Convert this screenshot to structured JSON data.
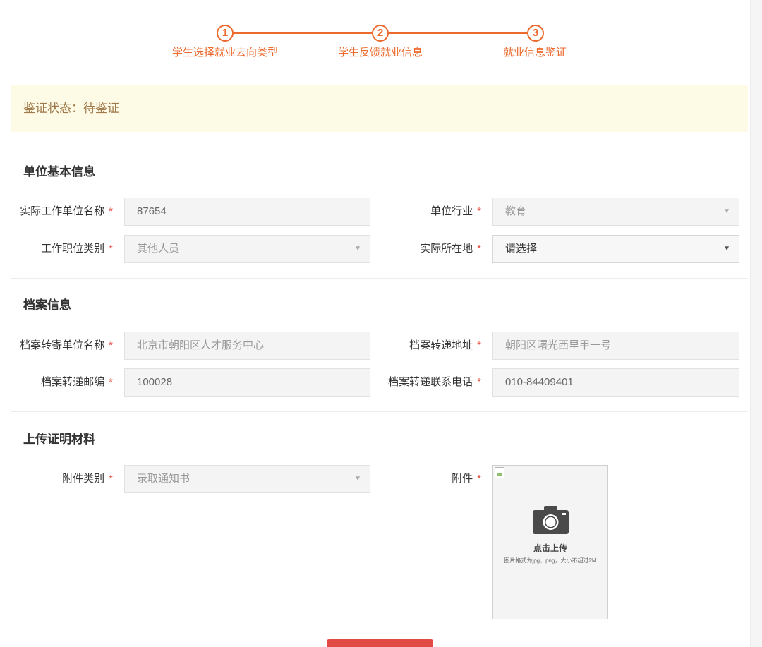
{
  "stepper": {
    "steps": [
      {
        "number": "1",
        "label": "学生选择就业去向类型"
      },
      {
        "number": "2",
        "label": "学生反馈就业信息"
      },
      {
        "number": "3",
        "label": "就业信息鉴证"
      }
    ]
  },
  "status": {
    "text": "鉴证状态：待鉴证"
  },
  "sections": {
    "unit": {
      "title": "单位基本信息",
      "fields": {
        "company_name": {
          "label": "实际工作单位名称",
          "value": "87654"
        },
        "industry": {
          "label": "单位行业",
          "value": "教育"
        },
        "position_type": {
          "label": "工作职位类别",
          "value": "其他人员"
        },
        "location": {
          "label": "实际所在地",
          "value": "请选择"
        }
      }
    },
    "archive": {
      "title": "档案信息",
      "fields": {
        "recipient": {
          "label": "档案转寄单位名称",
          "placeholder": "北京市朝阳区人才服务中心"
        },
        "address": {
          "label": "档案转递地址",
          "placeholder": "朝阳区曙光西里甲一号"
        },
        "postcode": {
          "label": "档案转递邮编",
          "value": "100028"
        },
        "phone": {
          "label": "档案转递联系电话",
          "value": "010-84409401"
        }
      }
    },
    "upload": {
      "title": "上传证明材料",
      "fields": {
        "attachment_type": {
          "label": "附件类别",
          "value": "录取通知书"
        },
        "attachment": {
          "label": "附件"
        }
      },
      "upload_box": {
        "title": "点击上传",
        "hint": "图片格式为jpg、png，大小不超过2M"
      }
    }
  },
  "required_mark": "*",
  "caret_glyph": "▼",
  "icons": {
    "camera": "camera-icon",
    "broken_image": "broken-image-icon"
  },
  "colors": {
    "accent": "#ec6a2d",
    "status_bg": "#fdfbe6",
    "status_text": "#a07a4c",
    "required": "#e74c3c",
    "submit": "#e24a46"
  }
}
